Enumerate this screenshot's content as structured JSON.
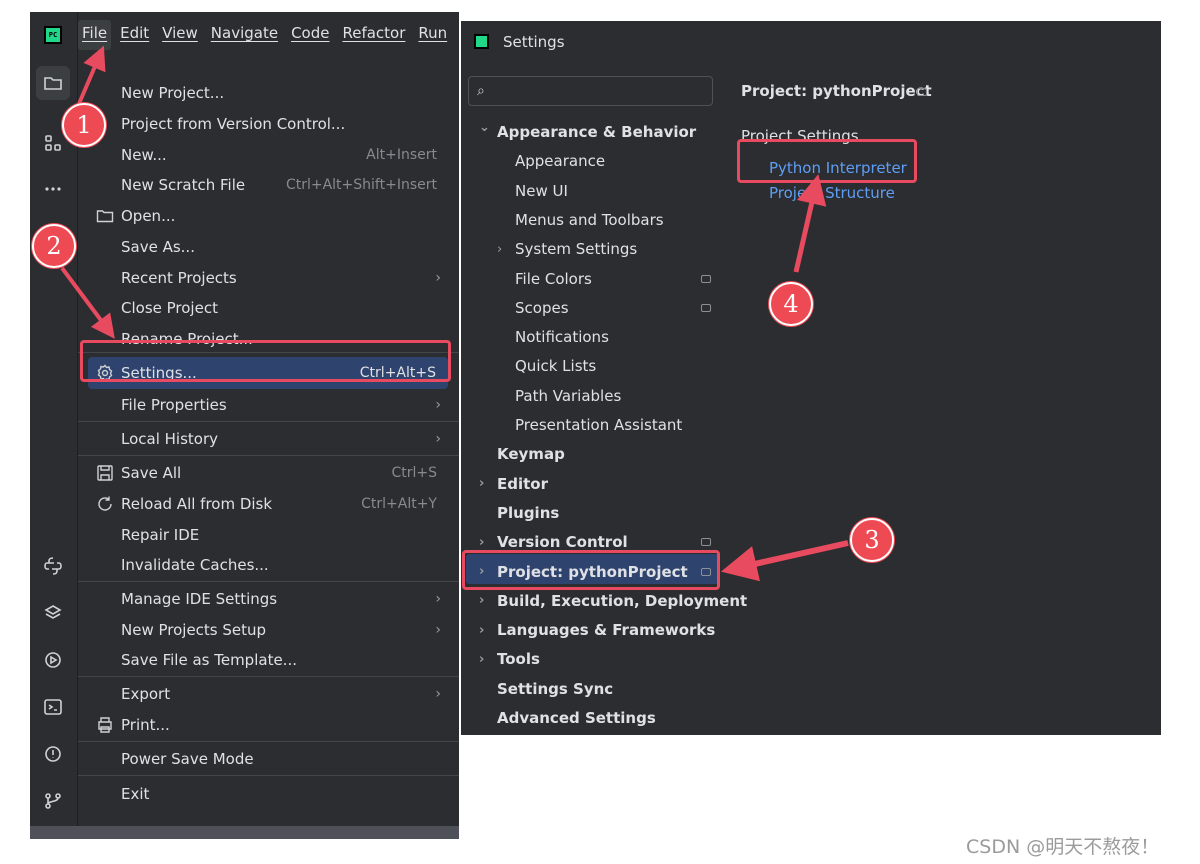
{
  "ide": {
    "logo_text": "PC",
    "menubar": [
      "File",
      "Edit",
      "View",
      "Navigate",
      "Code",
      "Refactor",
      "Run"
    ],
    "file_menu": [
      {
        "label": "New Project...",
        "shortcut": "",
        "submenu": false,
        "icon": ""
      },
      {
        "label": "Project from Version Control...",
        "shortcut": "",
        "submenu": false,
        "icon": ""
      },
      {
        "label": "New...",
        "shortcut": "Alt+Insert",
        "submenu": false,
        "icon": ""
      },
      {
        "label": "New Scratch File",
        "shortcut": "Ctrl+Alt+Shift+Insert",
        "submenu": false,
        "icon": ""
      },
      {
        "label": "Open...",
        "shortcut": "",
        "submenu": false,
        "icon": "folder-icon"
      },
      {
        "label": "Save As...",
        "shortcut": "",
        "submenu": false,
        "icon": ""
      },
      {
        "label": "Recent Projects",
        "shortcut": "",
        "submenu": true,
        "icon": ""
      },
      {
        "label": "Close Project",
        "shortcut": "",
        "submenu": false,
        "icon": ""
      },
      {
        "label": "Rename Project...",
        "shortcut": "",
        "submenu": false,
        "icon": ""
      },
      {
        "label": "Settings...",
        "shortcut": "Ctrl+Alt+S",
        "submenu": false,
        "icon": "gear-icon",
        "highlighted": true
      },
      {
        "label": "File Properties",
        "shortcut": "",
        "submenu": true,
        "icon": ""
      },
      {
        "label": "Local History",
        "shortcut": "",
        "submenu": true,
        "icon": ""
      },
      {
        "label": "Save All",
        "shortcut": "Ctrl+S",
        "submenu": false,
        "icon": "save-icon"
      },
      {
        "label": "Reload All from Disk",
        "shortcut": "Ctrl+Alt+Y",
        "submenu": false,
        "icon": "reload-icon"
      },
      {
        "label": "Repair IDE",
        "shortcut": "",
        "submenu": false,
        "icon": ""
      },
      {
        "label": "Invalidate Caches...",
        "shortcut": "",
        "submenu": false,
        "icon": ""
      },
      {
        "label": "Manage IDE Settings",
        "shortcut": "",
        "submenu": true,
        "icon": ""
      },
      {
        "label": "New Projects Setup",
        "shortcut": "",
        "submenu": true,
        "icon": ""
      },
      {
        "label": "Save File as Template...",
        "shortcut": "",
        "submenu": false,
        "icon": ""
      },
      {
        "label": "Export",
        "shortcut": "",
        "submenu": true,
        "icon": ""
      },
      {
        "label": "Print...",
        "shortcut": "",
        "submenu": false,
        "icon": "print-icon"
      },
      {
        "label": "Power Save Mode",
        "shortcut": "",
        "submenu": false,
        "icon": ""
      },
      {
        "label": "Exit",
        "shortcut": "",
        "submenu": false,
        "icon": ""
      }
    ],
    "tool_icons": [
      "project-folder-icon",
      "structure-icon",
      "more-icon",
      "python-console-icon",
      "layers-icon",
      "services-icon",
      "terminal-icon",
      "problems-icon",
      "git-icon"
    ]
  },
  "settings": {
    "title": "Settings",
    "search_placeholder": "",
    "tree": [
      {
        "label": "Appearance & Behavior",
        "bold": true,
        "expanded": true,
        "level": 0
      },
      {
        "label": "Appearance",
        "bold": false,
        "level": 1
      },
      {
        "label": "New UI",
        "bold": false,
        "level": 1
      },
      {
        "label": "Menus and Toolbars",
        "bold": false,
        "level": 1
      },
      {
        "label": "System Settings",
        "bold": false,
        "level": 1,
        "collapsed": true
      },
      {
        "label": "File Colors",
        "bold": false,
        "level": 1,
        "badge": true
      },
      {
        "label": "Scopes",
        "bold": false,
        "level": 1,
        "badge": true
      },
      {
        "label": "Notifications",
        "bold": false,
        "level": 1
      },
      {
        "label": "Quick Lists",
        "bold": false,
        "level": 1
      },
      {
        "label": "Path Variables",
        "bold": false,
        "level": 1
      },
      {
        "label": "Presentation Assistant",
        "bold": false,
        "level": 1
      },
      {
        "label": "Keymap",
        "bold": true,
        "level": 0
      },
      {
        "label": "Editor",
        "bold": true,
        "level": 0,
        "collapsed": true
      },
      {
        "label": "Plugins",
        "bold": true,
        "level": 0
      },
      {
        "label": "Version Control",
        "bold": true,
        "level": 0,
        "collapsed": true,
        "badge": true
      },
      {
        "label": "Project: pythonProject",
        "bold": true,
        "level": 0,
        "collapsed": true,
        "badge": true,
        "selected": true
      },
      {
        "label": "Build, Execution, Deployment",
        "bold": true,
        "level": 0,
        "collapsed": true
      },
      {
        "label": "Languages & Frameworks",
        "bold": true,
        "level": 0,
        "collapsed": true
      },
      {
        "label": "Tools",
        "bold": true,
        "level": 0,
        "collapsed": true
      },
      {
        "label": "Settings Sync",
        "bold": true,
        "level": 0
      },
      {
        "label": "Advanced Settings",
        "bold": true,
        "level": 0
      }
    ],
    "right": {
      "header": "Project: pythonProject",
      "subheader": "Project Settings",
      "links": [
        "Python Interpreter",
        "Project Structure"
      ]
    }
  },
  "annotations": {
    "steps": [
      "1",
      "2",
      "3",
      "4"
    ],
    "color": "#e84a5f"
  },
  "watermark": "CSDN @明天不熬夜！",
  "colors": {
    "background": "#2b2d30",
    "selection": "#2e436e",
    "link": "#5f9ef5",
    "accent_red": "#e84a5f"
  }
}
